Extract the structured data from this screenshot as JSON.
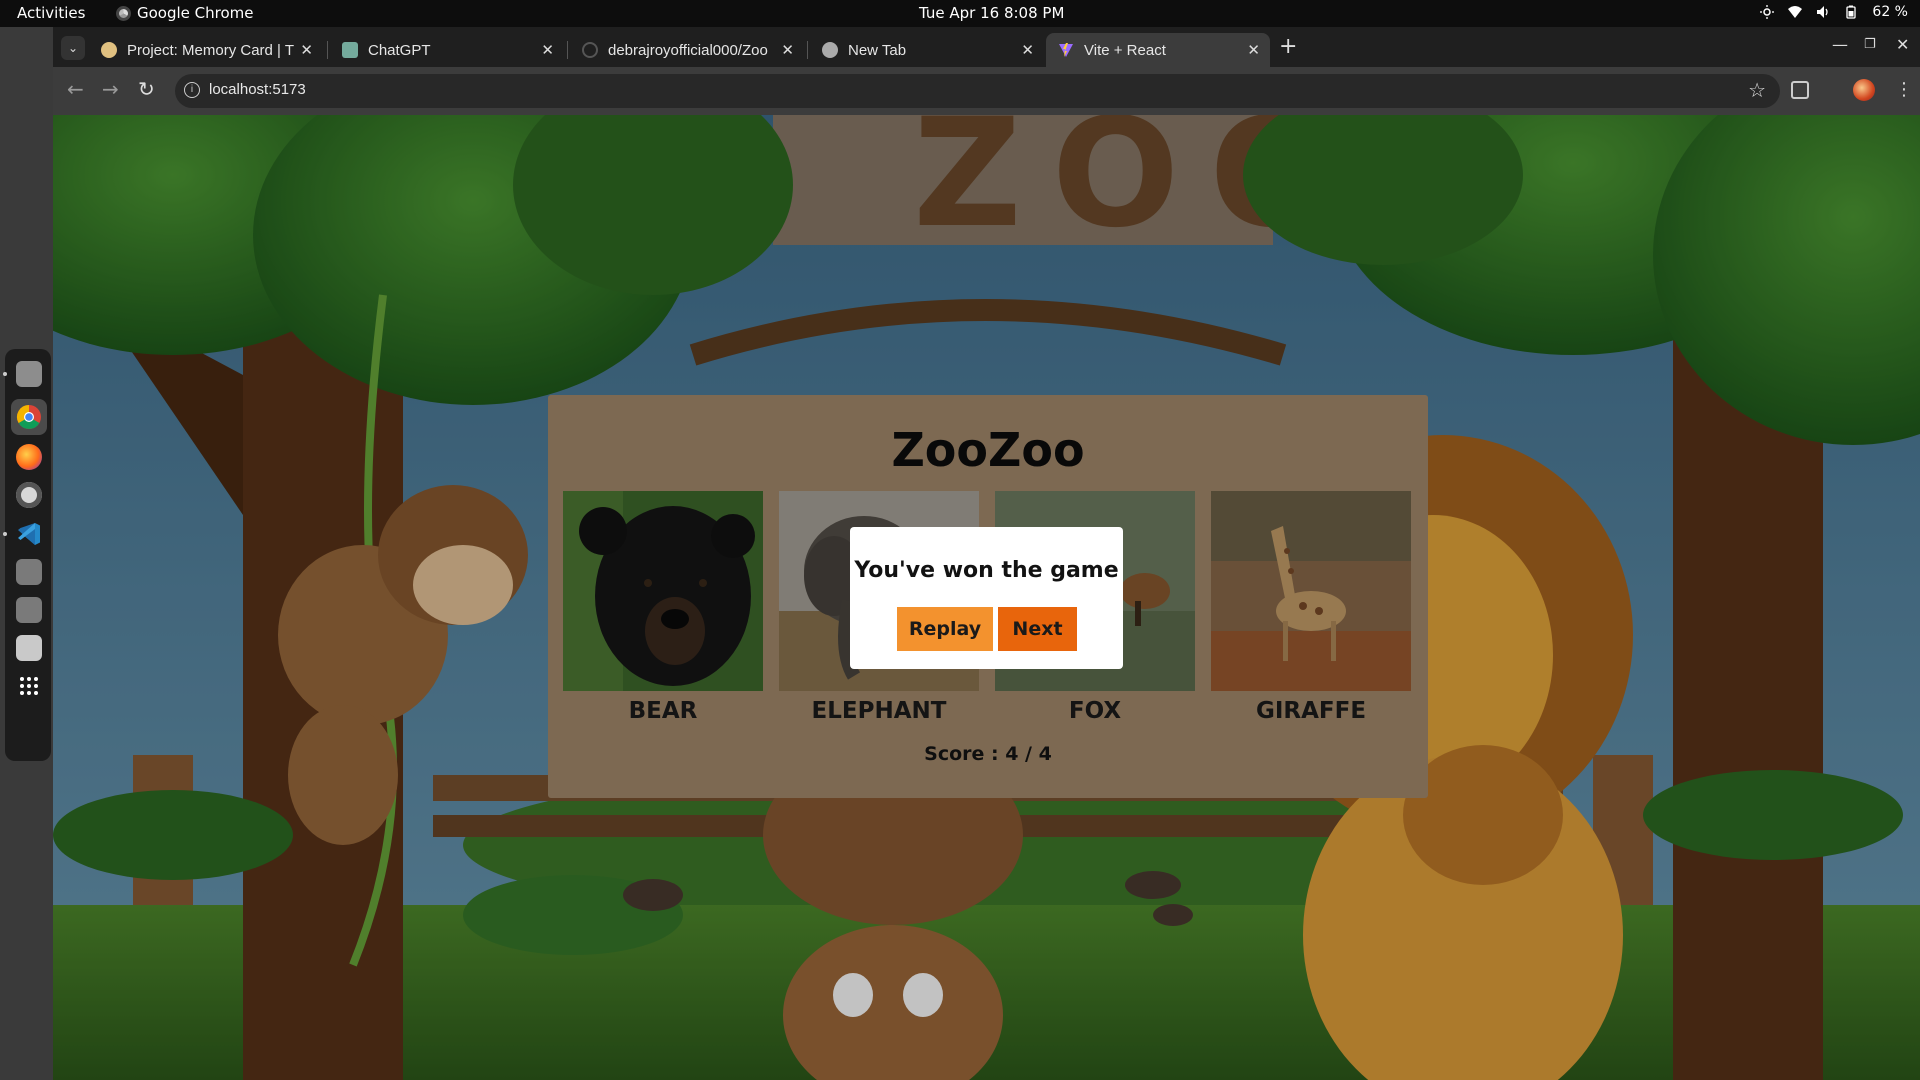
{
  "topbar": {
    "activities": "Activities",
    "app_name": "Google Chrome",
    "clock": "Tue Apr 16  8:08 PM",
    "battery": "62 %"
  },
  "browser": {
    "tabs": [
      {
        "title": "Project: Memory Card | T",
        "icon": "odin-project-icon"
      },
      {
        "title": "ChatGPT",
        "icon": "chatgpt-icon"
      },
      {
        "title": "debrajroyofficial000/Zoo",
        "icon": "github-icon"
      },
      {
        "title": "New Tab",
        "icon": "chrome-icon"
      },
      {
        "title": "Vite + React",
        "icon": "vite-icon",
        "active": true
      }
    ],
    "url": "localhost:5173"
  },
  "game": {
    "title": "ZooZoo",
    "animals": [
      {
        "name": "BEAR"
      },
      {
        "name": "ELEPHANT"
      },
      {
        "name": "FOX"
      },
      {
        "name": "GIRAFFE"
      }
    ],
    "score": "Score : 4 / 4",
    "dialog": {
      "message": "You've won the game",
      "replay": "Replay",
      "next": "Next"
    }
  },
  "colors": {
    "card_bg": "#a58a6c",
    "replay_button": "#f3922e",
    "next_button": "#e8650c"
  }
}
